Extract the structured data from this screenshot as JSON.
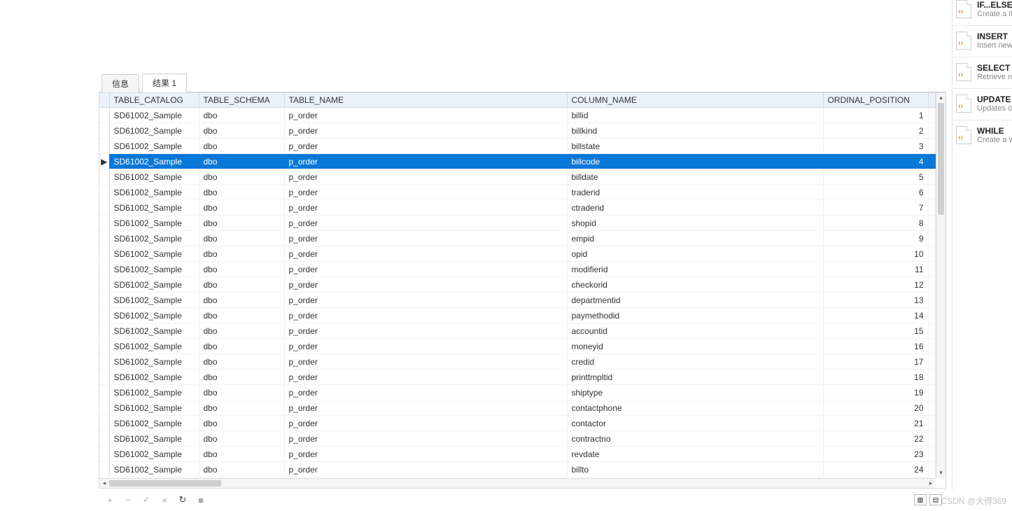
{
  "tabs": {
    "info": "信息",
    "result": "结果 1",
    "active": "result"
  },
  "columns": {
    "catalog": "TABLE_CATALOG",
    "schema": "TABLE_SCHEMA",
    "tname": "TABLE_NAME",
    "cname": "COLUMN_NAME",
    "opos": "ORDINAL_POSITION"
  },
  "selected_index": 3,
  "rows": [
    {
      "catalog": "SD61002_Sample",
      "schema": "dbo",
      "tname": "p_order",
      "cname": "billid",
      "opos": 1
    },
    {
      "catalog": "SD61002_Sample",
      "schema": "dbo",
      "tname": "p_order",
      "cname": "billkind",
      "opos": 2
    },
    {
      "catalog": "SD61002_Sample",
      "schema": "dbo",
      "tname": "p_order",
      "cname": "billstate",
      "opos": 3
    },
    {
      "catalog": "SD61002_Sample",
      "schema": "dbo",
      "tname": "p_order",
      "cname": "billcode",
      "opos": 4
    },
    {
      "catalog": "SD61002_Sample",
      "schema": "dbo",
      "tname": "p_order",
      "cname": "billdate",
      "opos": 5
    },
    {
      "catalog": "SD61002_Sample",
      "schema": "dbo",
      "tname": "p_order",
      "cname": "traderid",
      "opos": 6
    },
    {
      "catalog": "SD61002_Sample",
      "schema": "dbo",
      "tname": "p_order",
      "cname": "ctraderid",
      "opos": 7
    },
    {
      "catalog": "SD61002_Sample",
      "schema": "dbo",
      "tname": "p_order",
      "cname": "shopid",
      "opos": 8
    },
    {
      "catalog": "SD61002_Sample",
      "schema": "dbo",
      "tname": "p_order",
      "cname": "empid",
      "opos": 9
    },
    {
      "catalog": "SD61002_Sample",
      "schema": "dbo",
      "tname": "p_order",
      "cname": "opid",
      "opos": 10
    },
    {
      "catalog": "SD61002_Sample",
      "schema": "dbo",
      "tname": "p_order",
      "cname": "modifierid",
      "opos": 11
    },
    {
      "catalog": "SD61002_Sample",
      "schema": "dbo",
      "tname": "p_order",
      "cname": "checkorid",
      "opos": 12
    },
    {
      "catalog": "SD61002_Sample",
      "schema": "dbo",
      "tname": "p_order",
      "cname": "departmentid",
      "opos": 13
    },
    {
      "catalog": "SD61002_Sample",
      "schema": "dbo",
      "tname": "p_order",
      "cname": "paymethodid",
      "opos": 14
    },
    {
      "catalog": "SD61002_Sample",
      "schema": "dbo",
      "tname": "p_order",
      "cname": "accountid",
      "opos": 15
    },
    {
      "catalog": "SD61002_Sample",
      "schema": "dbo",
      "tname": "p_order",
      "cname": "moneyid",
      "opos": 16
    },
    {
      "catalog": "SD61002_Sample",
      "schema": "dbo",
      "tname": "p_order",
      "cname": "credid",
      "opos": 17
    },
    {
      "catalog": "SD61002_Sample",
      "schema": "dbo",
      "tname": "p_order",
      "cname": "printtmpltid",
      "opos": 18
    },
    {
      "catalog": "SD61002_Sample",
      "schema": "dbo",
      "tname": "p_order",
      "cname": "shiptype",
      "opos": 19
    },
    {
      "catalog": "SD61002_Sample",
      "schema": "dbo",
      "tname": "p_order",
      "cname": "contactphone",
      "opos": 20
    },
    {
      "catalog": "SD61002_Sample",
      "schema": "dbo",
      "tname": "p_order",
      "cname": "contactor",
      "opos": 21
    },
    {
      "catalog": "SD61002_Sample",
      "schema": "dbo",
      "tname": "p_order",
      "cname": "contractno",
      "opos": 22
    },
    {
      "catalog": "SD61002_Sample",
      "schema": "dbo",
      "tname": "p_order",
      "cname": "revdate",
      "opos": 23
    },
    {
      "catalog": "SD61002_Sample",
      "schema": "dbo",
      "tname": "p_order",
      "cname": "billto",
      "opos": 24
    }
  ],
  "row_marker": "▶",
  "toolbar": {
    "add": "+",
    "remove": "−",
    "apply": "✓",
    "cancel": "×",
    "refresh": "↻",
    "stop": "■"
  },
  "view_toggle": {
    "grid": "▦",
    "form": "▤"
  },
  "snippets": [
    {
      "title": "IF...ELSE",
      "desc": "Create a IF"
    },
    {
      "title": "INSERT",
      "desc": "Insert new"
    },
    {
      "title": "SELECT",
      "desc": "Retrieve ro"
    },
    {
      "title": "UPDATE",
      "desc": "Updates or named tab"
    },
    {
      "title": "WHILE",
      "desc": "Create a W within a W as the loo"
    }
  ],
  "icon_glyph": "‹›",
  "watermark": "CSDN @大得369"
}
